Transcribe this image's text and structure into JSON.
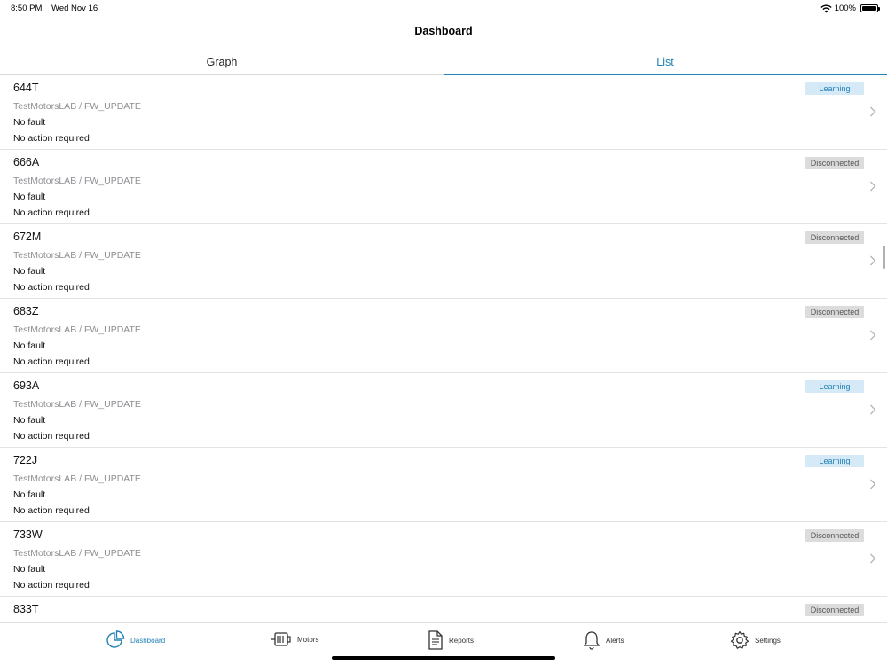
{
  "status": {
    "time": "8:50 PM",
    "date": "Wed Nov 16",
    "battery": "100%"
  },
  "nav": {
    "title": "Dashboard"
  },
  "tabs": [
    {
      "label": "Graph"
    },
    {
      "label": "List"
    }
  ],
  "rows": [
    {
      "id": "644T",
      "path": "TestMotorsLAB / FW_UPDATE",
      "fault": "No fault",
      "action": "No action required",
      "status": "Learning"
    },
    {
      "id": "666A",
      "path": "TestMotorsLAB / FW_UPDATE",
      "fault": "No fault",
      "action": "No action required",
      "status": "Disconnected"
    },
    {
      "id": "672M",
      "path": "TestMotorsLAB / FW_UPDATE",
      "fault": "No fault",
      "action": "No action required",
      "status": "Disconnected"
    },
    {
      "id": "683Z",
      "path": "TestMotorsLAB / FW_UPDATE",
      "fault": "No fault",
      "action": "No action required",
      "status": "Disconnected"
    },
    {
      "id": "693A",
      "path": "TestMotorsLAB / FW_UPDATE",
      "fault": "No fault",
      "action": "No action required",
      "status": "Learning"
    },
    {
      "id": "722J",
      "path": "TestMotorsLAB / FW_UPDATE",
      "fault": "No fault",
      "action": "No action required",
      "status": "Learning"
    },
    {
      "id": "733W",
      "path": "TestMotorsLAB / FW_UPDATE",
      "fault": "No fault",
      "action": "No action required",
      "status": "Disconnected"
    },
    {
      "id": "833T",
      "status": "Disconnected"
    }
  ],
  "tabbar": {
    "dashboard": "Dashboard",
    "motors": "Motors",
    "reports": "Reports",
    "alerts": "Alerts",
    "settings": "Settings"
  },
  "colors": {
    "accent": "#2382b5",
    "learning_bg": "#d5e9f7",
    "disconnected_bg": "#dcdcdc",
    "secondary_text": "#8e8e93"
  },
  "icons": {
    "dashboard": "pie-chart-icon",
    "motors": "motor-icon",
    "reports": "document-icon",
    "alerts": "bell-icon",
    "settings": "gear-icon",
    "row_disclosure": "chevron-right-icon"
  }
}
